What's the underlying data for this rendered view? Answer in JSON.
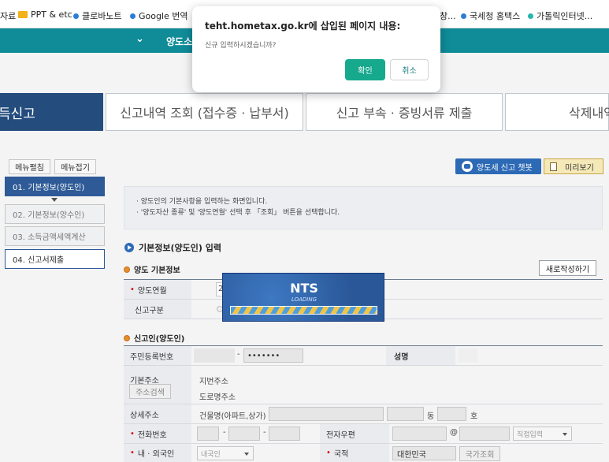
{
  "bookmarks": [
    {
      "label": "자료",
      "icon": "none"
    },
    {
      "label": "PPT & etc",
      "icon": "folder-icon"
    },
    {
      "label": "클로바노트",
      "icon": "blue-dot-icon"
    },
    {
      "label": "Google 번역",
      "icon": "blue-dot-icon"
    },
    {
      "label": "창...",
      "icon": "none"
    },
    {
      "label": "국세청 홈택스",
      "icon": "blue-dot-icon"
    },
    {
      "label": "가톨릭인터넷...",
      "icon": "teal-dot-icon"
    }
  ],
  "header": {
    "title": "양도소"
  },
  "tabs": [
    {
      "label": "득신고"
    },
    {
      "label": "신고내역 조회 (접수증 · 납부서)"
    },
    {
      "label": "신고 부속 · 증빙서류 제출"
    },
    {
      "label": "삭제내역"
    }
  ],
  "menu_buttons": {
    "edit": "메뉴펼침",
    "fold": "메뉴접기"
  },
  "menu": [
    {
      "label": "01. 기본정보(양도인)"
    },
    {
      "label": "02. 기본정보(양수인)"
    },
    {
      "label": "03. 소득금액세액계산"
    },
    {
      "label": "04. 신고서제출"
    }
  ],
  "actions": {
    "chatbot": "양도세 신고 챗봇",
    "preview": "미리보기"
  },
  "notice": [
    "· 양도인의 기본사항을 입력하는 화면입니다.",
    "· '양도자산 종류' 및 '양도연월' 선택 후 「조회」 버튼을 선택합니다."
  ],
  "section": {
    "title": "기본정보(양도인) 입력"
  },
  "transfer": {
    "title": "양도 기본정보",
    "new_button": "새로작성하기",
    "year_label": "양도연월",
    "type_label": "신고구분"
  },
  "reporter": {
    "title": "신고인(양도인)",
    "ssn_label": "주민등록번호",
    "ssn_sep": "-",
    "ssn_value": "•••••••",
    "name_label": "성명",
    "addr_label": "기본주소",
    "addr_search": "주소검색",
    "lot_addr": "지번주소",
    "road_addr": "도로명주소",
    "detail_label": "상세주소",
    "building_label": "건물명(아파트,상가)",
    "dong": "동",
    "ho": "호",
    "phone_label": "전화번호",
    "email_label": "전자우편",
    "at": "@",
    "email_select": "직접입력",
    "nation_label": "내 · 외국인",
    "nation_select": "내국인",
    "country_label": "국적",
    "country_value": "대한민국",
    "country_btn": "국가조회"
  },
  "dialog": {
    "title": "teht.hometax.go.kr에 삽입된 페이지 내용:",
    "message": "신규 입력하시겠습니까?",
    "ok": "확인",
    "cancel": "취소"
  },
  "loading": {
    "title": "NTS",
    "subtitle": "LOADING"
  },
  "colors": {
    "teal": "#0f8c98",
    "navy": "#244d7e",
    "ok": "#17a98e"
  }
}
